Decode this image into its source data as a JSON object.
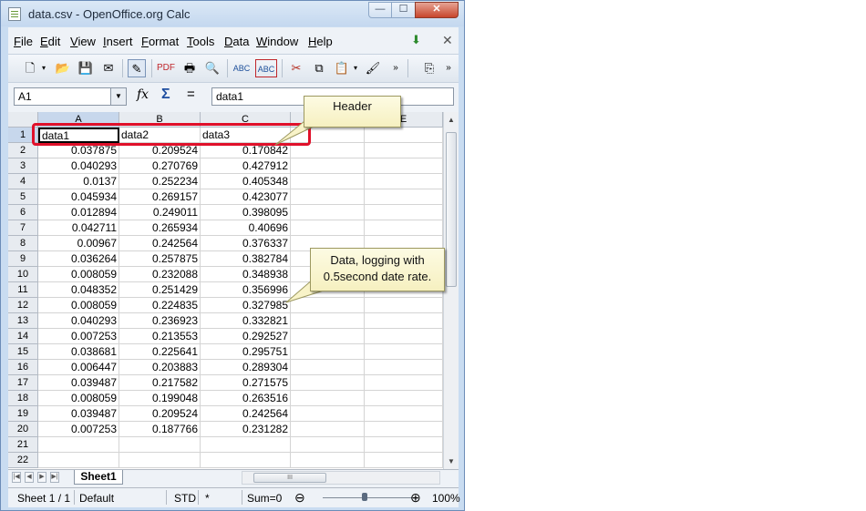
{
  "window": {
    "title": "data.csv - OpenOffice.org Calc",
    "controls": {
      "minimize": "—",
      "maximize": "☐",
      "close": "✕"
    }
  },
  "menubar": {
    "items": [
      {
        "u": "F",
        "rest": "ile"
      },
      {
        "u": "E",
        "rest": "dit"
      },
      {
        "u": "V",
        "rest": "iew"
      },
      {
        "u": "I",
        "rest": "nsert"
      },
      {
        "u": "F",
        "rest": "ormat",
        "pre": ""
      },
      {
        "u": "T",
        "rest": "ools"
      },
      {
        "u": "D",
        "rest": "ata"
      },
      {
        "u": "W",
        "rest": "indow"
      },
      {
        "u": "H",
        "rest": "elp"
      }
    ],
    "close_doc": "✕"
  },
  "formula": {
    "cell_ref": "A1",
    "content": "data1",
    "fx": "fx",
    "sum": "Σ",
    "equals": "="
  },
  "grid": {
    "columns": [
      "A",
      "B",
      "C",
      "D",
      "E"
    ],
    "selected_column": "A",
    "selected_row": "1",
    "header": [
      "data1",
      "data2",
      "data3"
    ],
    "rows": [
      [
        "0.037875",
        "0.209524",
        "0.170842"
      ],
      [
        "0.040293",
        "0.270769",
        "0.427912"
      ],
      [
        "0.0137",
        "0.252234",
        "0.405348"
      ],
      [
        "0.045934",
        "0.269157",
        "0.423077"
      ],
      [
        "0.012894",
        "0.249011",
        "0.398095"
      ],
      [
        "0.042711",
        "0.265934",
        "0.40696"
      ],
      [
        "0.00967",
        "0.242564",
        "0.376337"
      ],
      [
        "0.036264",
        "0.257875",
        "0.382784"
      ],
      [
        "0.008059",
        "0.232088",
        "0.348938"
      ],
      [
        "0.048352",
        "0.251429",
        "0.356996"
      ],
      [
        "0.008059",
        "0.224835",
        "0.327985"
      ],
      [
        "0.040293",
        "0.236923",
        "0.332821"
      ],
      [
        "0.007253",
        "0.213553",
        "0.292527"
      ],
      [
        "0.038681",
        "0.225641",
        "0.295751"
      ],
      [
        "0.006447",
        "0.203883",
        "0.289304"
      ],
      [
        "0.039487",
        "0.217582",
        "0.271575"
      ],
      [
        "0.008059",
        "0.199048",
        "0.263516"
      ],
      [
        "0.039487",
        "0.209524",
        "0.242564"
      ],
      [
        "0.007253",
        "0.187766",
        "0.231282"
      ]
    ],
    "extra_rows": [
      "21",
      "22"
    ]
  },
  "tabs": {
    "sheet": "Sheet1",
    "scroll_grip": "III"
  },
  "status": {
    "sheet": "Sheet 1 / 1",
    "style": "Default",
    "mode": "STD",
    "modified": "*",
    "sum": "Sum=0",
    "zoom_minus": "⊖",
    "zoom_plus": "⊕",
    "zoom": "100%",
    "zoom_level_fraction": 0.46
  },
  "annotations": {
    "header_callout": "Header",
    "data_callout_line1": "Data, logging with",
    "data_callout_line2": "0.5second date rate."
  },
  "colors": {
    "highlight": "#e0102a",
    "callout_fill": "#f8f3c8",
    "selection_header": "#c7d7ec"
  }
}
